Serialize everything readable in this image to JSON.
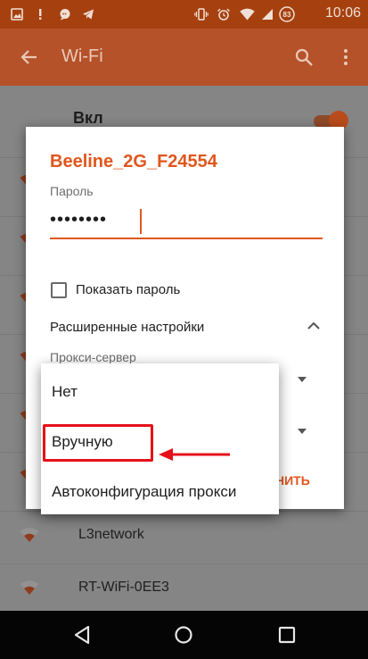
{
  "status_bar": {
    "time": "10:06",
    "battery_level": "83",
    "icons": [
      "image-icon",
      "notification-icon",
      "chat-icon",
      "telegram-icon",
      "vibrate-icon",
      "alarm-icon",
      "wifi-icon",
      "signal-icon",
      "battery-icon"
    ]
  },
  "toolbar": {
    "title": "Wi-Fi",
    "back_icon": "back-arrow-icon",
    "search_icon": "search-icon",
    "more_icon": "more-vert-icon"
  },
  "wifi_list": {
    "toggle_label": "Вкл",
    "toggle_on": true,
    "networks": [
      {
        "name": "L3network"
      },
      {
        "name": "RT-WiFi-0EE3"
      }
    ]
  },
  "dialog": {
    "title": "Beeline_2G_F24554",
    "password_label": "Пароль",
    "password_value": "••••••••",
    "show_password_label": "Показать пароль",
    "show_password_checked": false,
    "advanced_label": "Расширенные настройки",
    "proxy_label": "Прокси-сервер",
    "save_partial": "НИТЬ"
  },
  "proxy_menu": {
    "items": [
      "Нет",
      "Вручную",
      "Автоконфигурация прокси"
    ],
    "highlighted": "Вручную"
  },
  "colors": {
    "accent": "#e0561c",
    "annotation": "#e61019",
    "toolbar": "#b5522a",
    "status_bar": "#a6410f"
  }
}
